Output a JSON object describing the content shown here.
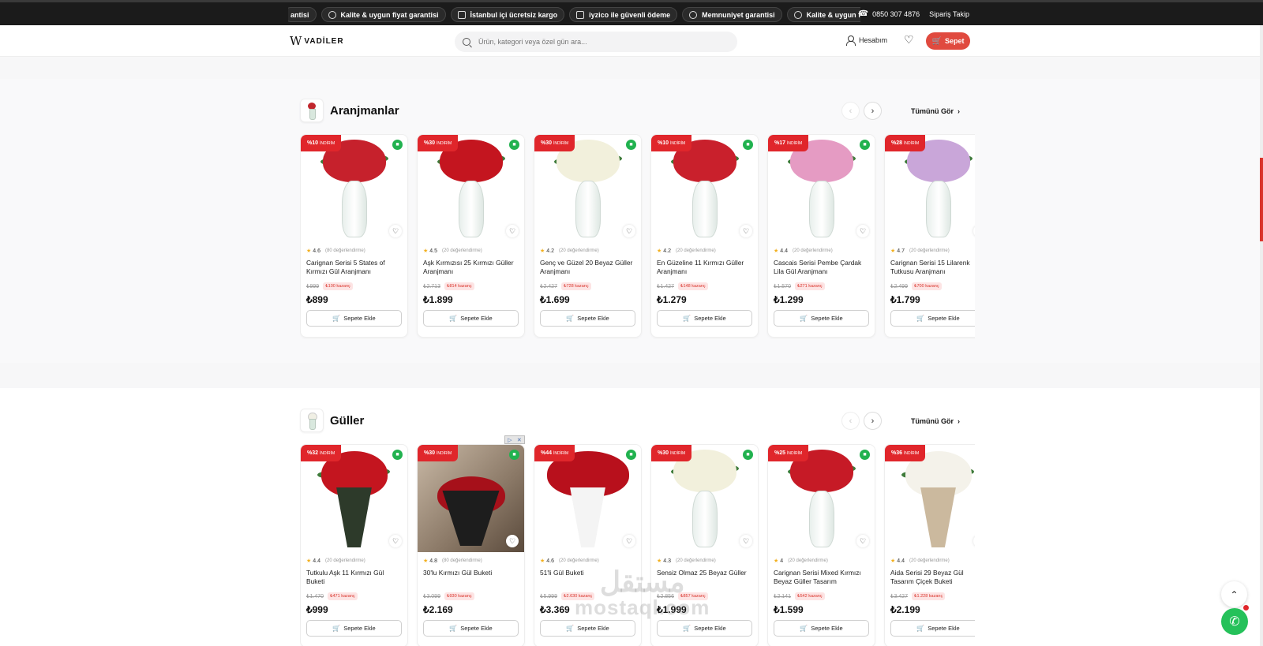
{
  "topbar": {
    "ticker": [
      {
        "icon": "shield-check-icon",
        "label": "antisi"
      },
      {
        "icon": "shield-check-icon",
        "label": "Kalite & uygun fiyat garantisi"
      },
      {
        "icon": "truck-icon",
        "label": "İstanbul içi ücretsiz kargo"
      },
      {
        "icon": "credit-card-icon",
        "label": "iyzico ile güvenli ödeme"
      },
      {
        "icon": "shield-check-icon",
        "label": "Memnuniyet garantisi"
      },
      {
        "icon": "shield-check-icon",
        "label": "Kalite & uygun fiyat ga"
      }
    ],
    "phone": "0850 307 4876",
    "order_tracking": "Sipariş Takip"
  },
  "header": {
    "logo": "VADİLER",
    "search_placeholder": "Ürün, kategori veya özel gün ara...",
    "account": "Hesabım",
    "cart": "Sepet"
  },
  "sections": [
    {
      "title": "Aranjmanlar",
      "see_all": "Tümünü Gör",
      "products": [
        {
          "discount": "%10",
          "discount_label": "İNDİRİM",
          "rating": "4.6",
          "reviews": "(80 değerlendirme)",
          "name": "Carignan Serisi 5 States of Kırmızı Gül Aranjmanı",
          "old_price": "₺999",
          "gain": "₺100 kazanç",
          "price": "₺899",
          "add": "Sepete Ekle",
          "bloom": "#c6212c",
          "style": "vase"
        },
        {
          "discount": "%30",
          "discount_label": "İNDİRİM",
          "rating": "4.5",
          "reviews": "(20 değerlendirme)",
          "name": "Aşk Kırmızısı 25 Kırmızı Güller Aranjmanı",
          "old_price": "₺2.713",
          "gain": "₺814 kazanç",
          "price": "₺1.899",
          "add": "Sepete Ekle",
          "bloom": "#c4151f",
          "style": "vase"
        },
        {
          "discount": "%30",
          "discount_label": "İNDİRİM",
          "rating": "4.2",
          "reviews": "(20 değerlendirme)",
          "name": "Genç ve Güzel 20 Beyaz Güller Aranjmanı",
          "old_price": "₺2.427",
          "gain": "₺728 kazanç",
          "price": "₺1.699",
          "add": "Sepete Ekle",
          "bloom": "#f2f0dc",
          "style": "vase"
        },
        {
          "discount": "%10",
          "discount_label": "İNDİRİM",
          "rating": "4.2",
          "reviews": "(20 değerlendirme)",
          "name": "En Güzeline 11 Kırmızı Güller Aranjmanı",
          "old_price": "₺1.427",
          "gain": "₺148 kazanç",
          "price": "₺1.279",
          "add": "Sepete Ekle",
          "bloom": "#c9202c",
          "style": "vase"
        },
        {
          "discount": "%17",
          "discount_label": "İNDİRİM",
          "rating": "4.4",
          "reviews": "(20 değerlendirme)",
          "name": "Cascais Serisi Pembe Çardak Lila Gül Aranjmanı",
          "old_price": "₺1.570",
          "gain": "₺271 kazanç",
          "price": "₺1.299",
          "add": "Sepete Ekle",
          "bloom": "#e59bc3",
          "style": "vase"
        },
        {
          "discount": "%28",
          "discount_label": "İNDİRİM",
          "rating": "4.7",
          "reviews": "(20 değerlendirme)",
          "name": "Carignan Serisi 15 Lilarenk Tutkusu Aranjmanı",
          "old_price": "₺2.499",
          "gain": "₺700 kazanç",
          "price": "₺1.799",
          "add": "Sepete Ekle",
          "bloom": "#c9a6d9",
          "style": "vase"
        }
      ]
    },
    {
      "title": "Güller",
      "see_all": "Tümünü Gör",
      "products": [
        {
          "discount": "%32",
          "discount_label": "İNDİRİM",
          "rating": "4.4",
          "reviews": "(20 değerlendirme)",
          "name": "Tutkulu Aşk 11 Kırmızı Gül Buketi",
          "old_price": "₺1.470",
          "gain": "₺471 kazanç",
          "price": "₺999",
          "add": "Sepete Ekle",
          "bloom": "#c4151f",
          "style": "bouquet"
        },
        {
          "discount": "%30",
          "discount_label": "İNDİRİM",
          "rating": "4.8",
          "reviews": "(80 değerlendirme)",
          "name": "30'lu Kırmızı Gül Buketi",
          "old_price": "₺3.099",
          "gain": "₺930 kazanç",
          "price": "₺2.169",
          "add": "Sepete Ekle",
          "bloom": "#a6101a",
          "style": "photo"
        },
        {
          "discount": "%44",
          "discount_label": "İNDİRİM",
          "rating": "4.6",
          "reviews": "(20 değerlendirme)",
          "name": "51'li Gül Buketi",
          "old_price": "₺5.999",
          "gain": "₺2.630 kazanç",
          "price": "₺3.369",
          "add": "Sepete Ekle",
          "bloom": "#b8101c",
          "style": "big"
        },
        {
          "discount": "%30",
          "discount_label": "İNDİRİM",
          "rating": "4.3",
          "reviews": "(20 değerlendirme)",
          "name": "Sensiz Olmaz 25 Beyaz Güller",
          "old_price": "₺2.856",
          "gain": "₺857 kazanç",
          "price": "₺1.999",
          "add": "Sepete Ekle",
          "bloom": "#f2f0dc",
          "style": "vase"
        },
        {
          "discount": "%25",
          "discount_label": "İNDİRİM",
          "rating": "4",
          "reviews": "(20 değerlendirme)",
          "name": "Carignan Serisi Mixed Kırmızı Beyaz Güller Tasarım",
          "old_price": "₺2.141",
          "gain": "₺542 kazanç",
          "price": "₺1.599",
          "add": "Sepete Ekle",
          "bloom": "#c61a26",
          "style": "vase"
        },
        {
          "discount": "%36",
          "discount_label": "İNDİRİM",
          "rating": "4.4",
          "reviews": "(20 değerlendirme)",
          "name": "Aida Serisi 29 Beyaz Gül Tasarım Çiçek Buketi",
          "old_price": "₺3.427",
          "gain": "₺1.228 kazanç",
          "price": "₺2.199",
          "add": "Sepete Ekle",
          "bloom": "#f4f2ea",
          "style": "bouquet-wrap"
        }
      ]
    }
  ],
  "watermark": {
    "line1": "مستقل",
    "line2": "mostaql.com"
  }
}
